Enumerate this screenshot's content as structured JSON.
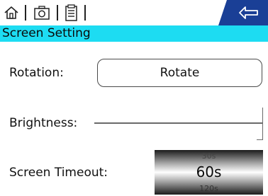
{
  "colors": {
    "title_bar": "#1ddcf2",
    "back_tab": "#1a3f96",
    "text": "#111111"
  },
  "toolbar": {
    "icons": [
      "home-icon",
      "camera-icon",
      "document-icon"
    ],
    "back_icon": "back-arrow-icon"
  },
  "header": {
    "title": "Screen Setting"
  },
  "rotation": {
    "label": "Rotation:",
    "button_label": "Rotate"
  },
  "brightness": {
    "label": "Brightness:",
    "level": 1.0
  },
  "screen_timeout": {
    "label": "Screen Timeout:",
    "prev_option": "30s",
    "selected": "60s",
    "next_option": "120s"
  }
}
